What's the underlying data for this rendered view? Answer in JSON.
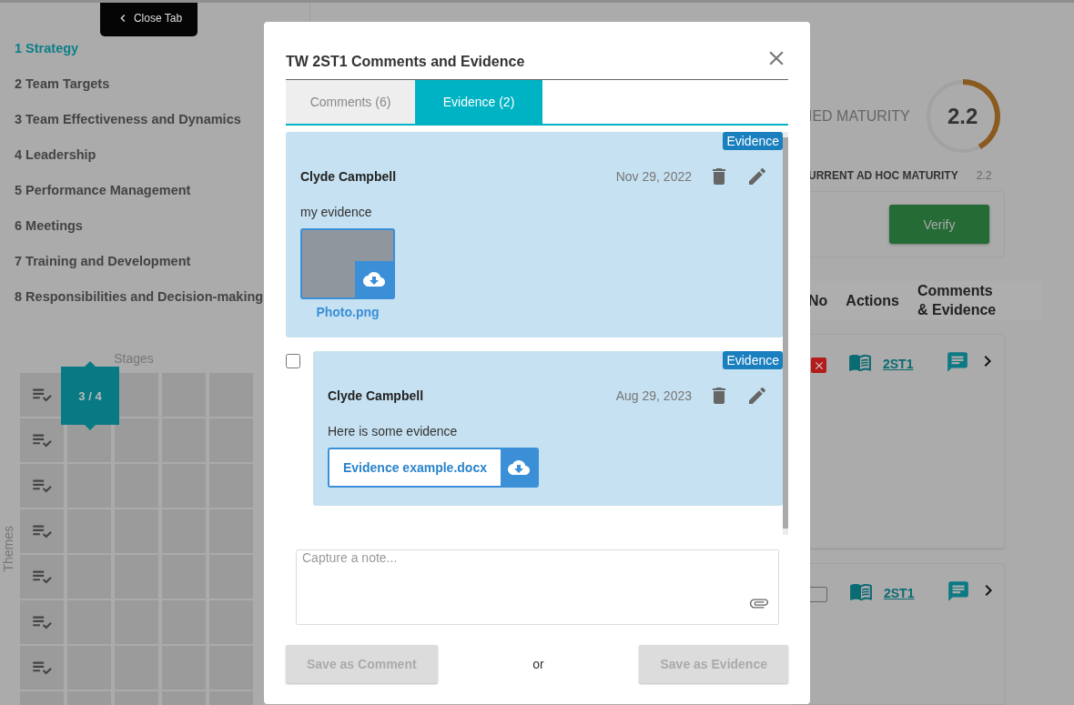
{
  "close_tab": {
    "label": "Close Tab"
  },
  "sidebar": {
    "items": [
      {
        "label": "1 Strategy",
        "selected": true
      },
      {
        "label": "2 Team Targets",
        "selected": false
      },
      {
        "label": "3 Team Effectiveness and Dynamics",
        "selected": false
      },
      {
        "label": "4 Leadership",
        "selected": false
      },
      {
        "label": "5 Performance Management",
        "selected": false
      },
      {
        "label": "6 Meetings",
        "selected": false
      },
      {
        "label": "7 Training and Development",
        "selected": false
      },
      {
        "label": "8 Responsibilities and Decision-making",
        "selected": false
      }
    ]
  },
  "stages_grid": {
    "title": "Stages",
    "axis_label": "Themes",
    "badge": "3 / 4"
  },
  "maturity": {
    "label": "IED MATURITY",
    "value": "2.2",
    "level": 0.42
  },
  "ad_hoc": {
    "label": "URRENT AD HOC MATURITY",
    "value": "2.2"
  },
  "verify_button": {
    "label": "Verify"
  },
  "table": {
    "columns": [
      "No",
      "Actions",
      "Comments\n& Evidence"
    ],
    "rows": [
      {
        "no_marked": true,
        "link": "2ST1"
      },
      {
        "no_marked": false,
        "link": "2ST1"
      }
    ]
  },
  "modal": {
    "title": "TW 2ST1 Comments and Evidence",
    "tabs": [
      {
        "label": "Comments (6)",
        "selected": false
      },
      {
        "label": "Evidence (2)",
        "selected": true
      }
    ],
    "entries": [
      {
        "badge": "Evidence",
        "author": "Clyde Campbell",
        "date": "Nov 29, 2022",
        "text": "my evidence",
        "attachment": {
          "kind": "image",
          "name": "Photo.png"
        }
      },
      {
        "badge": "Evidence",
        "author": "Clyde Campbell",
        "date": "Aug 29, 2023",
        "text": "Here is some evidence",
        "checkbox": {
          "checked": false
        },
        "attachment": {
          "kind": "file",
          "name": "Evidence example.docx"
        }
      }
    ],
    "note": {
      "placeholder": "Capture a note..."
    },
    "save_comment": {
      "label": "Save as Comment",
      "disabled": true
    },
    "or": "or",
    "save_evidence": {
      "label": "Save as Evidence",
      "disabled": true
    }
  }
}
